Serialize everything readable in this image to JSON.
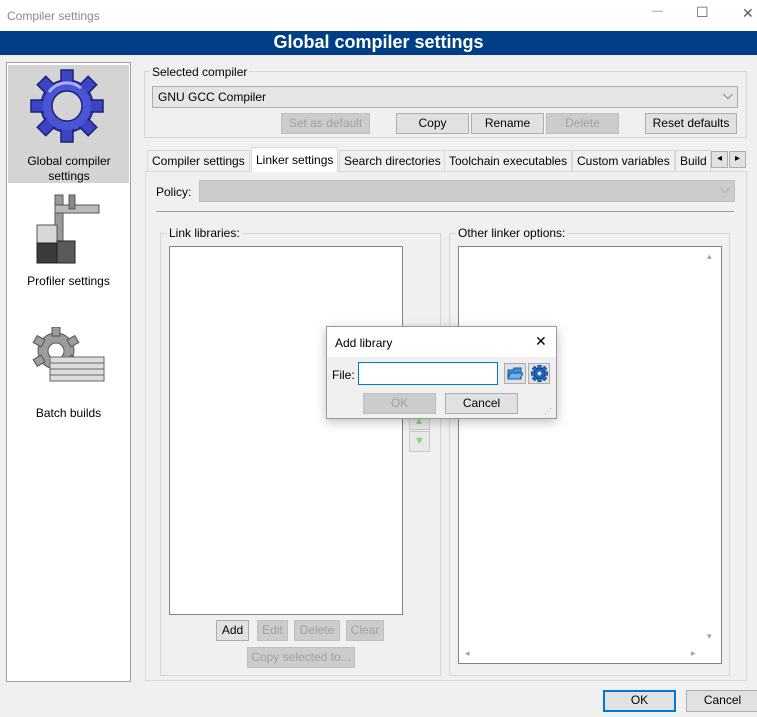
{
  "window": {
    "title": "Compiler settings",
    "banner": "Global compiler settings",
    "banner_color": "#003f87"
  },
  "sidebar": {
    "items": [
      {
        "label": "Global compiler settings",
        "icon": "gear-icon",
        "selected": true
      },
      {
        "label": "Profiler settings",
        "icon": "profiler-icon",
        "selected": false
      },
      {
        "label": "Batch builds",
        "icon": "batch-icon",
        "selected": false
      }
    ]
  },
  "compiler": {
    "group_label": "Selected compiler",
    "selected": "GNU GCC Compiler",
    "buttons": {
      "set_default": "Set as default",
      "copy": "Copy",
      "rename": "Rename",
      "delete": "Delete",
      "reset": "Reset defaults"
    }
  },
  "tabs": [
    {
      "label": "Compiler settings"
    },
    {
      "label": "Linker settings"
    },
    {
      "label": "Search directories"
    },
    {
      "label": "Toolchain executables"
    },
    {
      "label": "Custom variables"
    },
    {
      "label": "Build"
    }
  ],
  "linker": {
    "policy_label": "Policy:",
    "policy_value": "",
    "libraries_label": "Link libraries:",
    "other_options_label": "Other linker options:",
    "buttons": {
      "add": "Add",
      "edit": "Edit",
      "delete": "Delete",
      "clear": "Clear",
      "copy_selected": "Copy selected to..."
    }
  },
  "dialog": {
    "title": "Add library",
    "file_label": "File:",
    "file_value": "",
    "ok": "OK",
    "cancel": "Cancel"
  },
  "footer": {
    "ok": "OK",
    "cancel": "Cancel"
  },
  "title_controls": {
    "minimize": "—",
    "maximize": "☐",
    "close": "✕",
    "dialog_close": "✕"
  },
  "glyphs": {
    "dropdown": "⌵",
    "tab_left": "◂",
    "tab_right": "▸",
    "scroll_up": "▴",
    "scroll_down": "▾",
    "scroll_left": "◂",
    "scroll_right": "▸",
    "move_up": "▲",
    "move_down": "▼",
    "gear": "⚙",
    "folder": "▰"
  }
}
